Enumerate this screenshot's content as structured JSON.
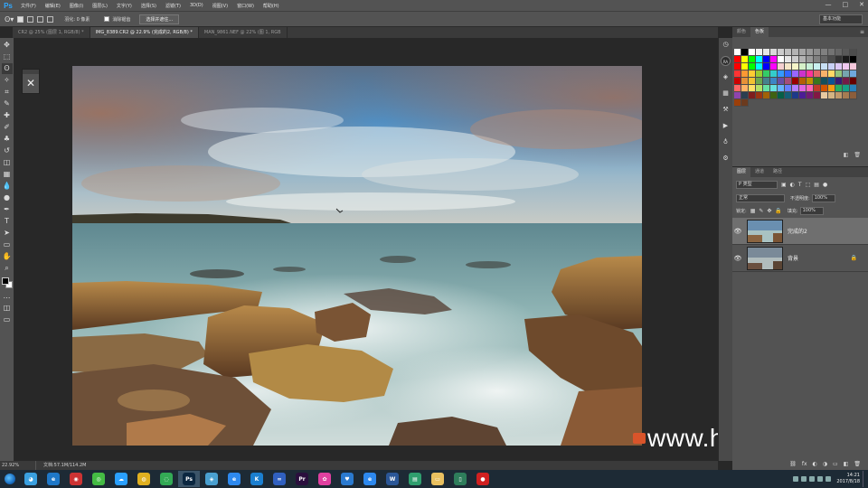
{
  "app": {
    "logo": "Ps",
    "menu": [
      "文件(F)",
      "编辑(E)",
      "图像(I)",
      "图层(L)",
      "文字(Y)",
      "选择(S)",
      "滤镜(T)",
      "3D(D)",
      "视图(V)",
      "窗口(W)",
      "帮助(H)"
    ],
    "window_controls": [
      "—",
      "□",
      "✕"
    ]
  },
  "options_bar": {
    "feather_label": "羽化: 0 像素",
    "antialias_label": "消除锯齿",
    "select_mask_button": "选择并遮住...",
    "workspace": "基本功能"
  },
  "tabs": [
    {
      "label": "CR2 @ 25% (图层 1, RGB/8) *",
      "active": false
    },
    {
      "label": "IMG_8389.CR2 @ 22.9% (完成的2, RGB/8) *",
      "active": true
    },
    {
      "label": "MAN_9861.NEF @ 22% (图 1, RGB",
      "active": false
    }
  ],
  "toolbar_icons": [
    "move-icon",
    "marquee-icon",
    "lasso-icon",
    "quick-select-icon",
    "crop-icon",
    "eyedropper-icon",
    "healing-icon",
    "brush-icon",
    "stamp-icon",
    "history-brush-icon",
    "eraser-icon",
    "gradient-icon",
    "blur-icon",
    "dodge-icon",
    "pen-icon",
    "type-icon",
    "path-select-icon",
    "shape-icon",
    "hand-icon",
    "zoom-icon",
    "more-tools-icon"
  ],
  "toolbar_glyphs": [
    "✥",
    "⬚",
    "ʘ",
    "✧",
    "⌗",
    "✎",
    "✚",
    "✐",
    "♣",
    "↺",
    "◫",
    "▦",
    "💧",
    "●",
    "✒",
    "T",
    "➤",
    "▭",
    "✋",
    "⌕",
    "…"
  ],
  "mini_panel_glyph": "✕",
  "status_bar": {
    "zoom": "22.92%",
    "doc_info": "文档:57.1M/114.2M"
  },
  "right_strip_icons": [
    "history-icon",
    "ra-icon",
    "3d-icon",
    "table-icon",
    "brush-settings-icon",
    "play-icon",
    "clone-source-icon",
    "styles-icon"
  ],
  "right_strip_glyphs": [
    "◷",
    "RA",
    "◈",
    "▦",
    "⚒",
    "▶",
    "♁",
    "⚙"
  ],
  "swatches_panel": {
    "tabs": [
      {
        "label": "颜色",
        "active": false
      },
      {
        "label": "色板",
        "active": true
      }
    ],
    "footer": [
      "◧",
      "🗑"
    ],
    "colors": [
      "#ffffff",
      "#000000",
      "#ffffff",
      "#f2f2f2",
      "#e6e6e6",
      "#d9d9d9",
      "#cccccc",
      "#bfbfbf",
      "#b3b3b3",
      "#a6a6a6",
      "#999999",
      "#8c8c8c",
      "#808080",
      "#737373",
      "#666666",
      "#595959",
      "#4d4d4d",
      "#ff0000",
      "#ffff00",
      "#00ff00",
      "#00ffff",
      "#0000ff",
      "#ff00ff",
      "#ffffff",
      "#e6e6e6",
      "#cccccc",
      "#b3b3b3",
      "#999999",
      "#808080",
      "#666666",
      "#4d4d4d",
      "#333333",
      "#1a1a1a",
      "#000000",
      "#ff0000",
      "#ffff00",
      "#00ff00",
      "#00ffff",
      "#0000ff",
      "#ff00ff",
      "#f5d0d0",
      "#f5e6c8",
      "#f5f5c8",
      "#d5f0c8",
      "#c8f0d8",
      "#c8f0f0",
      "#c8e0f5",
      "#c8d0f5",
      "#dcc8f5",
      "#f0c8f0",
      "#f5c8dc",
      "#ff3333",
      "#ff9933",
      "#ffcc33",
      "#99cc33",
      "#33cc66",
      "#33cccc",
      "#3399ff",
      "#3366ff",
      "#9966ff",
      "#cc33cc",
      "#ff3399",
      "#e06666",
      "#f6b26b",
      "#ffd966",
      "#93c47d",
      "#76a5af",
      "#6fa8dc",
      "#cc0000",
      "#e69138",
      "#f1c232",
      "#6aa84f",
      "#45818e",
      "#3d85c6",
      "#674ea7",
      "#a64d79",
      "#990000",
      "#b45f06",
      "#bf9000",
      "#38761d",
      "#134f5c",
      "#0b5394",
      "#351c75",
      "#741b47",
      "#660000",
      "#ff6666",
      "#ffb366",
      "#ffe066",
      "#b3e066",
      "#66e0a3",
      "#66e0e0",
      "#66b3ff",
      "#6680ff",
      "#b380ff",
      "#e066e0",
      "#ff66b3",
      "#c0392b",
      "#d35400",
      "#f39c12",
      "#27ae60",
      "#16a085",
      "#2980b9",
      "#8e44ad",
      "#2c3e50",
      "#7f1d1d",
      "#9a3412",
      "#a16207",
      "#3f6212",
      "#065f46",
      "#155e75",
      "#1e3a8a",
      "#4c1d95",
      "#701a75",
      "#831843",
      "#e8c9a0",
      "#d4b483",
      "#c19a6b",
      "#a67c52",
      "#8b5e3c",
      "#9b3f0a",
      "#6b3a1e"
    ]
  },
  "layers_panel": {
    "tabs": [
      {
        "label": "图层",
        "active": true
      },
      {
        "label": "通道",
        "active": false
      },
      {
        "label": "路径",
        "active": false
      }
    ],
    "filter_kind": "P 类型",
    "filter_glyphs": [
      "▣",
      "◐",
      "T",
      "⬚",
      "▤",
      "●"
    ],
    "blend_mode": "正常",
    "opacity_label": "不透明度:",
    "opacity_value": "100%",
    "lock_label": "锁定:",
    "lock_glyphs": [
      "▦",
      "✎",
      "✥",
      "🔒"
    ],
    "fill_label": "填充:",
    "fill_value": "100%",
    "eye_glyph": "👁",
    "lock_glyph": "🔒",
    "layers": [
      {
        "name": "完成的2",
        "selected": true,
        "locked": false
      },
      {
        "name": "背景",
        "selected": false,
        "locked": true
      }
    ],
    "footer": [
      "⛓",
      "fx",
      "◐",
      "◑",
      "▭",
      "◧",
      "🗑"
    ]
  },
  "watermark": "www.hunls.com",
  "taskbar": {
    "icons": [
      {
        "name": "qq-icon",
        "color": "#3aa0e0",
        "glyph": "◕"
      },
      {
        "name": "ie-icon",
        "color": "#1f78c8",
        "glyph": "e"
      },
      {
        "name": "kingsoft-icon",
        "color": "#cc3333",
        "glyph": "◉"
      },
      {
        "name": "360-icon",
        "color": "#44bb44",
        "glyph": "◎"
      },
      {
        "name": "cloud-icon",
        "color": "#2aa0ff",
        "glyph": "☁"
      },
      {
        "name": "chrome-icon",
        "color": "#e0b020",
        "glyph": "◍"
      },
      {
        "name": "browser-icon",
        "color": "#33aa55",
        "glyph": "◌"
      },
      {
        "name": "photoshop-icon",
        "color": "#0b2740",
        "glyph": "Ps"
      },
      {
        "name": "safari-icon",
        "color": "#4aa0d0",
        "glyph": "◈"
      },
      {
        "name": "ie2-icon",
        "color": "#2d89ef",
        "glyph": "e"
      },
      {
        "name": "kugou-icon",
        "color": "#1b7fd0",
        "glyph": "K"
      },
      {
        "name": "baidu-icon",
        "color": "#3060c0",
        "glyph": "∞"
      },
      {
        "name": "premiere-icon",
        "color": "#2a0f3d",
        "glyph": "Pr"
      },
      {
        "name": "picasa-icon",
        "color": "#e040a0",
        "glyph": "✿"
      },
      {
        "name": "fav-icon",
        "color": "#2a7ad0",
        "glyph": "♥"
      },
      {
        "name": "edge-icon",
        "color": "#2d89ef",
        "glyph": "e"
      },
      {
        "name": "word-icon",
        "color": "#2b5797",
        "glyph": "W"
      },
      {
        "name": "note-icon",
        "color": "#2f9e6e",
        "glyph": "▤"
      },
      {
        "name": "folder-icon",
        "color": "#e8c060",
        "glyph": "▭"
      },
      {
        "name": "proof-icon",
        "color": "#2e7d5b",
        "glyph": "▯"
      },
      {
        "name": "record-icon",
        "color": "#d02020",
        "glyph": "●"
      }
    ],
    "time": "14:21",
    "date": "2017/8/18"
  }
}
